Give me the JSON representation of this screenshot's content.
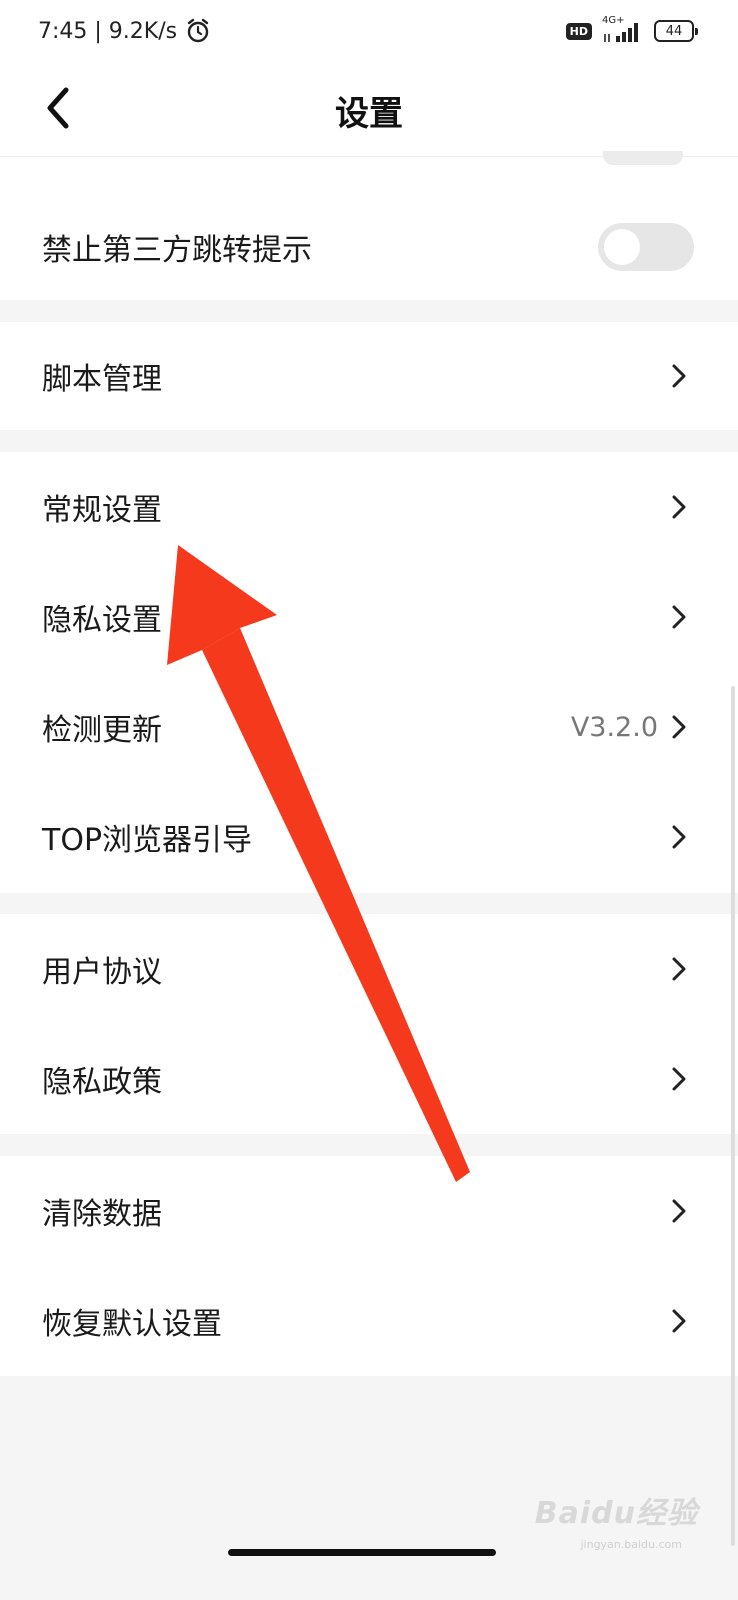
{
  "status_bar": {
    "time_speed": "7:45 | 9.2K/s",
    "hd_label": "HD",
    "network_label": "4G+",
    "battery": "44"
  },
  "nav": {
    "title": "设置"
  },
  "settings": {
    "toggle_row": {
      "label": "禁止第三方跳转提示",
      "on": false
    },
    "script_row": {
      "label": "脚本管理"
    },
    "general_group": [
      {
        "label": "常规设置",
        "value": ""
      },
      {
        "label": "隐私设置",
        "value": ""
      },
      {
        "label": "检测更新",
        "value": "V3.2.0"
      },
      {
        "label": "TOP浏览器引导",
        "value": ""
      }
    ],
    "legal_group": [
      {
        "label": "用户协议"
      },
      {
        "label": "隐私政策"
      }
    ],
    "data_group": [
      {
        "label": "清除数据"
      },
      {
        "label": "恢复默认设置"
      }
    ]
  },
  "watermark": {
    "text": "Baidu经验",
    "sub": "jingyan.baidu.com"
  },
  "colors": {
    "annotation_arrow": "#f4391c",
    "toggle_off": "#e6e6e6",
    "page_bg": "#f5f5f5"
  },
  "icons": [
    "alarm-icon",
    "back-arrow-icon",
    "chevron-right-icon",
    "signal-icon",
    "battery-icon"
  ]
}
